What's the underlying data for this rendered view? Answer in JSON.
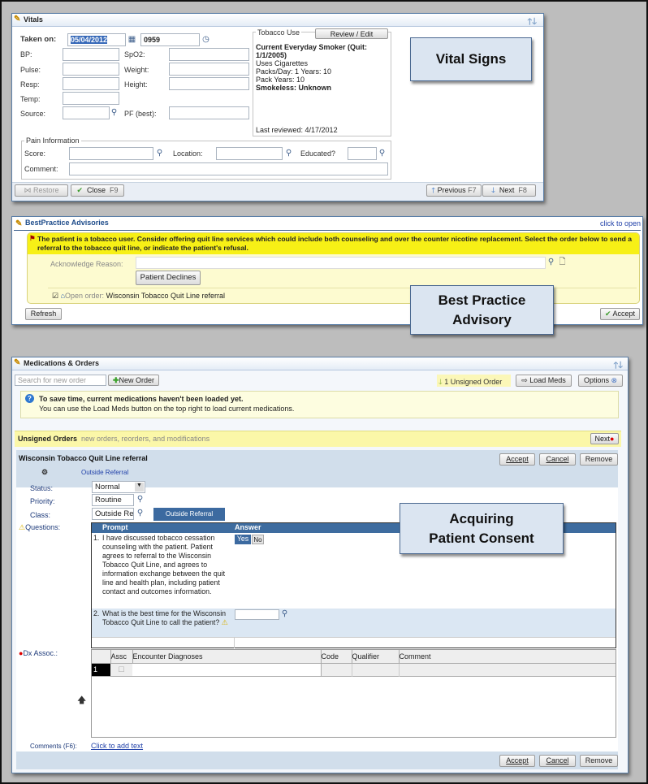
{
  "vitals": {
    "title": "Vitals",
    "taken_on_label": "Taken on:",
    "date": "05/04/2012",
    "time": "0959",
    "fields_left": [
      {
        "label": "BP:",
        "value": ""
      },
      {
        "label": "Pulse:",
        "value": ""
      },
      {
        "label": "Resp:",
        "value": ""
      },
      {
        "label": "Temp:",
        "value": ""
      },
      {
        "label": "Source:",
        "value": ""
      }
    ],
    "fields_right": [
      {
        "label": "SpO2:",
        "value": ""
      },
      {
        "label": "Weight:",
        "value": ""
      },
      {
        "label": "Height:",
        "value": ""
      },
      {
        "label": "PF (best):",
        "value": ""
      }
    ],
    "tobacco": {
      "legend": "Tobacco Use",
      "review_button": "Review / Edit",
      "status": "Current Everyday Smoker (Quit: 1/1/2005)",
      "type": "Uses Cigarettes",
      "packs": "Packs/Day: 1  Years: 10",
      "pack_years": "Pack Years: 10",
      "smokeless": "Smokeless: Unknown",
      "last_reviewed": "Last reviewed: 4/17/2012"
    },
    "pain": {
      "legend": "Pain Information",
      "score_label": "Score:",
      "location_label": "Location:",
      "educated_label": "Educated?",
      "comment_label": "Comment:"
    },
    "footer": {
      "restore": "Restore",
      "close": "Close",
      "close_key": "F9",
      "previous": "Previous",
      "previous_key": "F7",
      "next": "Next",
      "next_key": "F8"
    }
  },
  "bpa": {
    "title": "BestPractice Advisories",
    "click_to_open": "click to open",
    "message": "The patient is a tobacco user. Consider offering quit line services which could include both counseling and over the counter nicotine replacement. Select the order below to send a referral to the tobacco quit line, or indicate the patient's refusal.",
    "acknowledge_label": "Acknowledge Reason:",
    "acknowledge_value": "",
    "declines_button": "Patient Declines",
    "open_order_label": "Open order:",
    "open_order": "Wisconsin Tobacco Quit Line referral",
    "open_order_checked": true,
    "refresh": "Refresh",
    "accept": "Accept"
  },
  "meds": {
    "title": "Medications & Orders",
    "search_placeholder": "Search for new order",
    "new_order": "New Order",
    "unsigned_count": "1 Unsigned Order",
    "load_meds": "Load Meds",
    "options": "Options",
    "info_title": "To save time, current medications haven't been loaded yet.",
    "info_text": "You can use the Load Meds button on the top right to load current medications.",
    "unsigned_title": "Unsigned Orders",
    "unsigned_sub": "new orders, reorders, and modifications",
    "next": "Next",
    "order": {
      "title": "Wisconsin Tobacco Quit Line referral",
      "type_link": "Outside Referral",
      "accept": "Accept",
      "cancel": "Cancel",
      "remove": "Remove",
      "status_label": "Status:",
      "status": "Normal",
      "priority_label": "Priority:",
      "priority": "Routine",
      "class_label": "Class:",
      "class": "Outside Referral",
      "class_button": "Outside Referral",
      "questions_label": "Questions:",
      "prompt_header": "Prompt",
      "answer_header": "Answer",
      "questions": [
        {
          "num": "1.",
          "text": "I have discussed tobacco cessation counseling with the patient. Patient agrees to referral to the Wisconsin Tobacco Quit Line, and agrees to information exchange between the quit line and health plan, including patient contact and outcomes information.",
          "yes": "Yes",
          "no": "No",
          "selected": "Yes"
        },
        {
          "num": "2.",
          "text": "What is the best time for the Wisconsin Tobacco Quit Line to call the patient?",
          "answer": ""
        }
      ],
      "dx_label": "Dx Assoc.:",
      "dx_headers": [
        "Assc",
        "Encounter Diagnoses",
        "Code",
        "Qualifier",
        "Comment"
      ],
      "dx_rows": [
        {
          "num": "1",
          "assc": false,
          "diagnosis": "",
          "code": "",
          "qualifier": "",
          "comment": ""
        }
      ],
      "comments_label": "Comments (F6):",
      "comments_link": "Click to add text"
    }
  },
  "callouts": {
    "vitals": "Vital Signs",
    "bpa": "Best Practice Advisory",
    "consent": "Acquiring Patient Consent"
  }
}
